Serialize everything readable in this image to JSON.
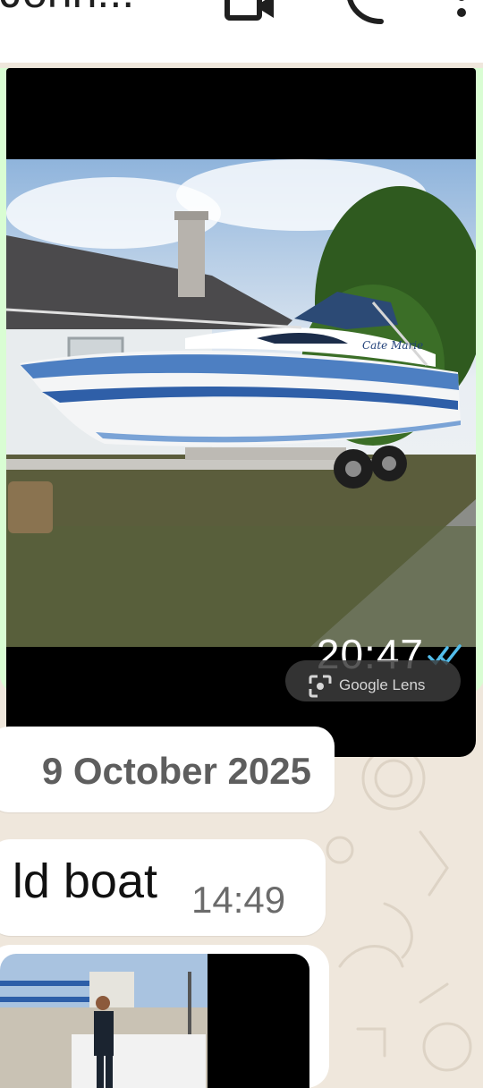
{
  "header": {
    "contact_name": "John...",
    "icons": [
      "video-call-icon",
      "voice-call-icon",
      "more-options-icon"
    ]
  },
  "colors": {
    "outgoing_bubble": "#d9fdd3",
    "incoming_bubble": "#ffffff",
    "wallpaper": "#efe7dc",
    "read_ticks": "#53bdeb"
  },
  "messages": [
    {
      "type": "image",
      "direction": "outgoing",
      "time": "20:47",
      "status": "read",
      "overlay_label": "Google Lens",
      "boat_name": "Cate Marie"
    },
    {
      "type": "date_separator",
      "text": "9 October 2025"
    },
    {
      "type": "text",
      "direction": "incoming",
      "text": "ld boat",
      "time": "14:49"
    },
    {
      "type": "image",
      "direction": "incoming"
    }
  ]
}
